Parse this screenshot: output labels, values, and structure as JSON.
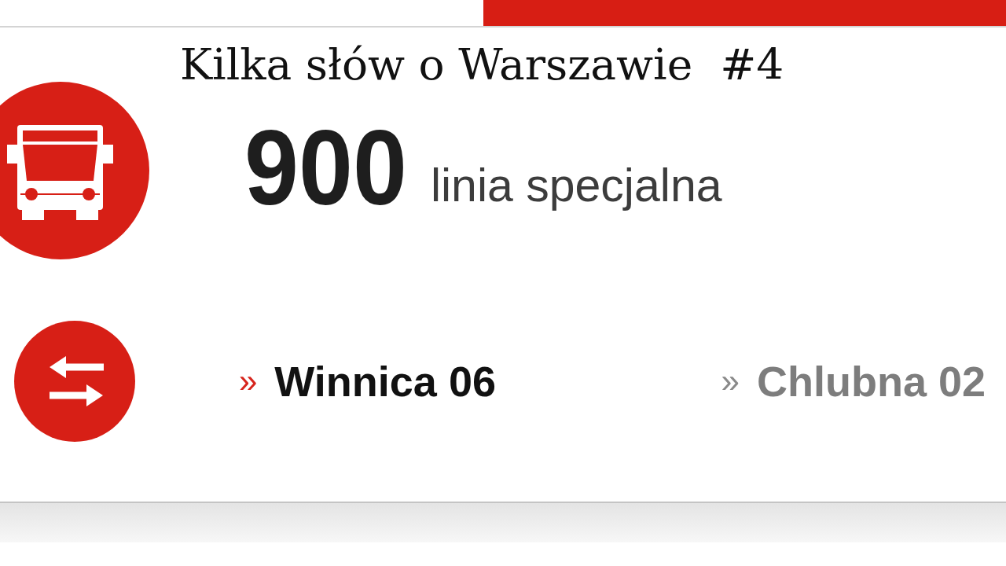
{
  "header": {
    "title": "Kilka słów o Warszawie  #4"
  },
  "line": {
    "number": "900",
    "type_label": "linia specjalna"
  },
  "directions": [
    {
      "marker": "»",
      "stop": "Winnica 06",
      "selected": true
    },
    {
      "marker": "»",
      "stop": "Chlubna 02",
      "selected": false
    }
  ]
}
